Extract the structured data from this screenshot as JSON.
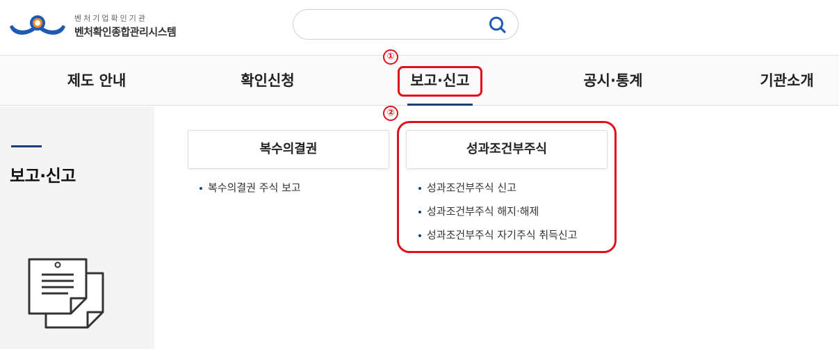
{
  "header": {
    "logo_subtitle": "벤처기업확인기관",
    "logo_title": "벤처확인종합관리시스템",
    "search_placeholder": ""
  },
  "nav": {
    "items": [
      {
        "label": "제도 안내"
      },
      {
        "label": "확인신청"
      },
      {
        "label": "보고·신고",
        "active": true
      },
      {
        "label": "공시·통계"
      },
      {
        "label": "기관소개"
      }
    ]
  },
  "annotations": {
    "step1": "①",
    "step2": "②",
    "highlight_color": "#e0101a"
  },
  "side": {
    "title": "보고·신고",
    "icon": "document-icon"
  },
  "submenu": {
    "groups": [
      {
        "title": "복수의결권",
        "items": [
          "복수의결권 주식 보고"
        ]
      },
      {
        "title": "성과조건부주식",
        "items": [
          "성과조건부주식 신고",
          "성과조건부주식 해지·해제",
          "성과조건부주식 자기주식 취득신고"
        ]
      }
    ]
  },
  "colors": {
    "accent": "#1a3d7c",
    "logo_blue": "#1e5ab4",
    "logo_orange": "#f08c1e"
  }
}
